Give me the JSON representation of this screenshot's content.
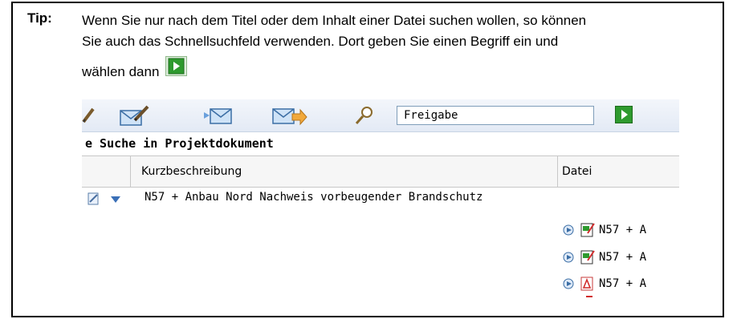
{
  "tip": {
    "label": "Tip:",
    "line1": "Wenn Sie nur nach dem Titel oder dem Inhalt einer Datei suchen wollen, so können",
    "line2": "Sie auch das Schnellsuchfeld verwenden. Dort geben Sie einen Begriff ein und",
    "line3": "wählen dann"
  },
  "screenshot": {
    "search_value": "Freigabe",
    "section_title": "e Suche in Projektdokument",
    "columns": [
      "Kurzbeschreibung",
      "Datei"
    ],
    "row": {
      "description": "N57 + Anbau Nord Nachweis vorbeugender Brandschutz",
      "files": [
        "N57 + A",
        "N57 + A",
        "N57 + A"
      ]
    }
  },
  "colors": {
    "go_button": "#2e9a2e",
    "toolbar_bg": "#e8eef7",
    "header_bg": "#f6f6f6"
  }
}
